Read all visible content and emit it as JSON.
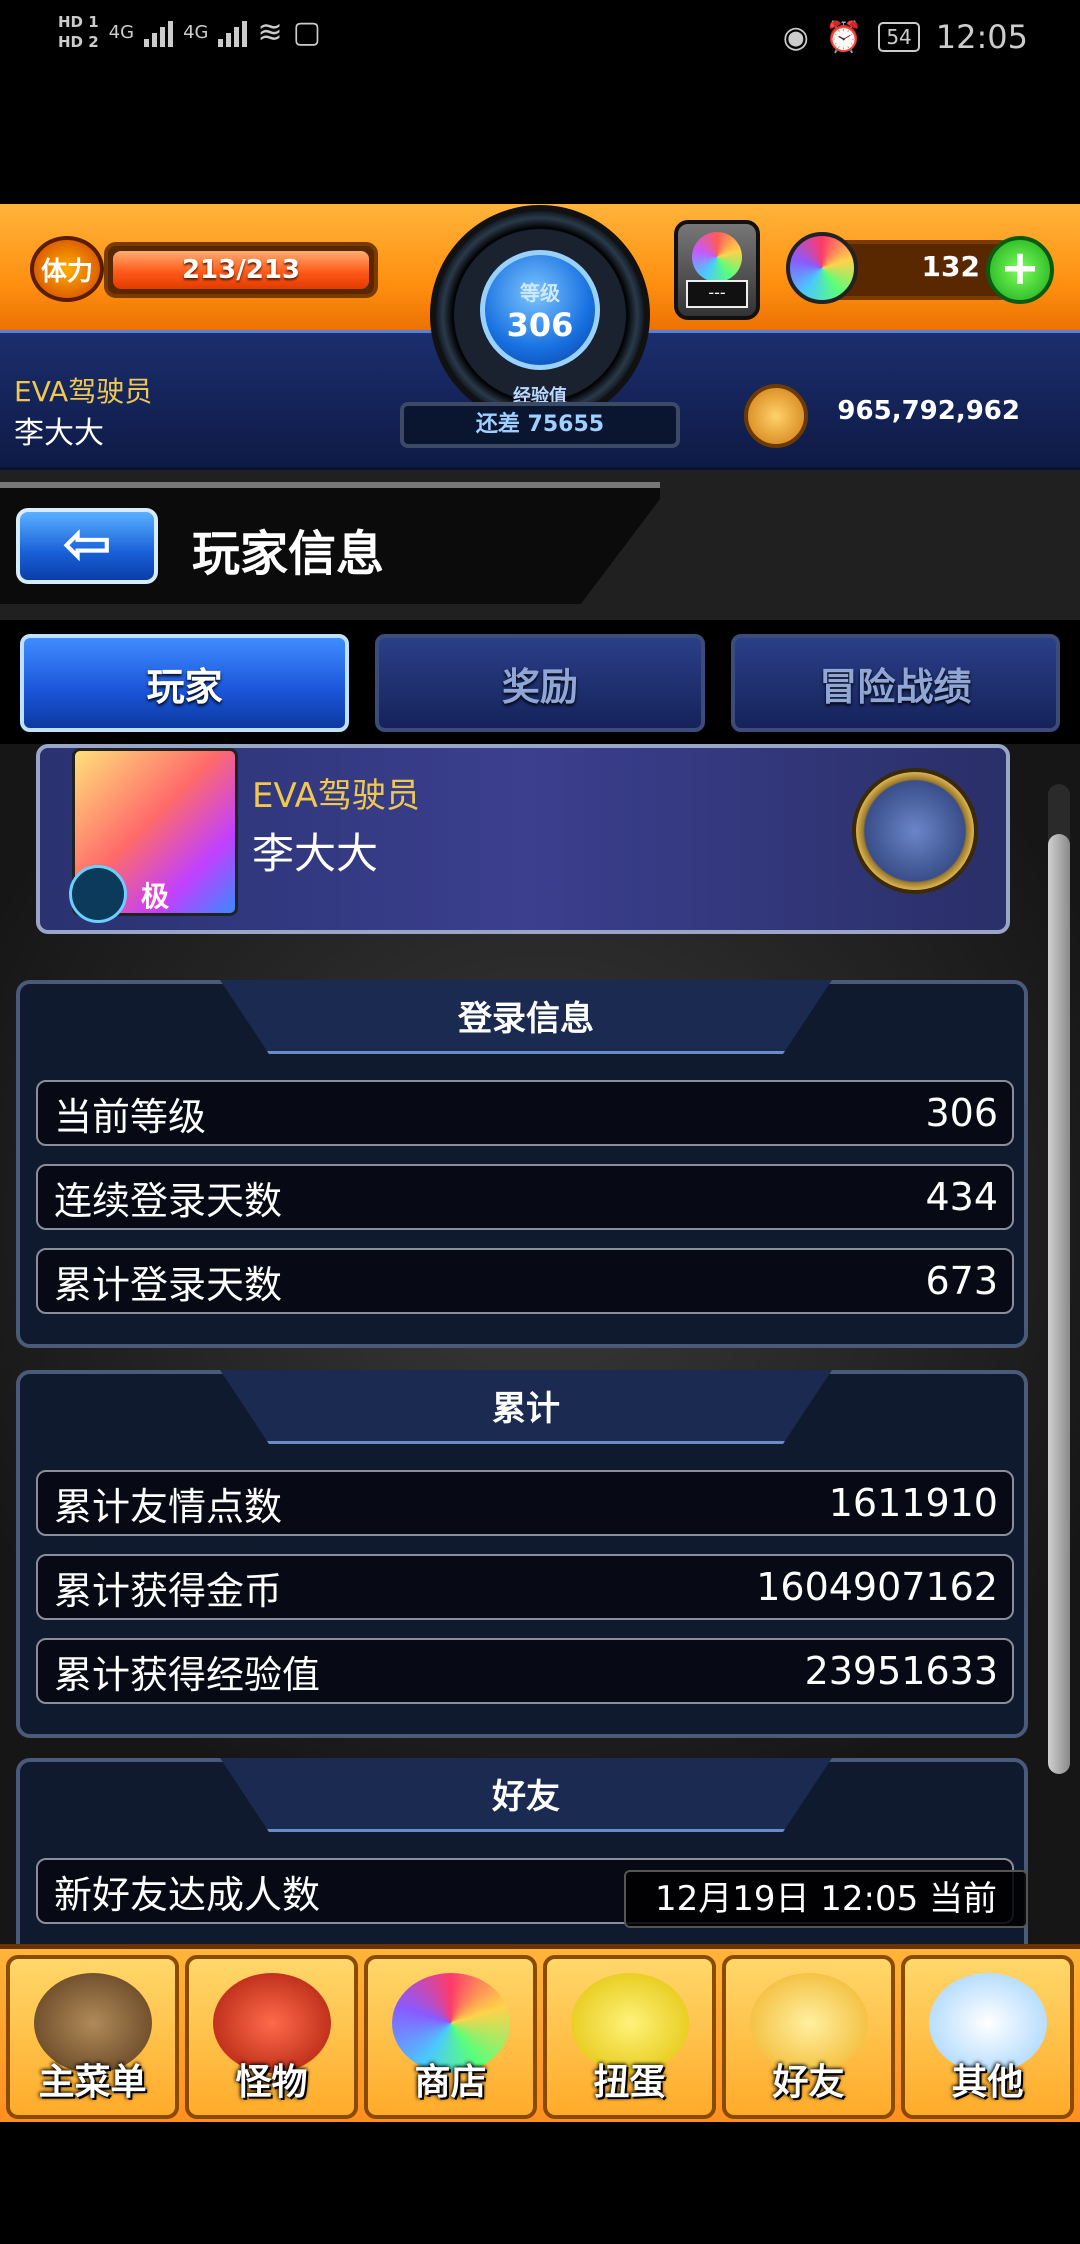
{
  "status_bar": {
    "hd1": "HD 1",
    "hd2": "HD 2",
    "net1": "4G",
    "net2": "4G",
    "battery": "54",
    "time": "12:05",
    "icons": [
      "eye-icon",
      "alarm-icon",
      "wifi-icon",
      "signal-icon"
    ]
  },
  "header": {
    "stamina_label": "体力",
    "stamina_text": "213/213",
    "stamina_fraction": 1.0,
    "level_label": "等级",
    "level_value": "306",
    "exp_label": "经验值",
    "exp_remaining": "还差 75655",
    "egg_slot_text": "---",
    "orb_count": "132",
    "add_label": "+",
    "subtitle": "EVA驾驶员",
    "player_name": "李大大",
    "gold": "965,792,962"
  },
  "page": {
    "title": "玩家信息",
    "back_label": "⇦"
  },
  "tabs": [
    {
      "label": "玩家",
      "active": true
    },
    {
      "label": "奖励",
      "active": false
    },
    {
      "label": "冒险战绩",
      "active": false
    }
  ],
  "profile": {
    "subtitle": "EVA驾驶员",
    "name": "李大大",
    "grade": "极"
  },
  "sections": {
    "login": {
      "title": "登录信息",
      "rows": [
        {
          "label": "当前等级",
          "value": "306"
        },
        {
          "label": "连续登录天数",
          "value": "434"
        },
        {
          "label": "累计登录天数",
          "value": "673"
        }
      ]
    },
    "totals": {
      "title": "累计",
      "rows": [
        {
          "label": "累计友情点数",
          "value": "1611910"
        },
        {
          "label": "累计获得金币",
          "value": "1604907162"
        },
        {
          "label": "累计获得经验值",
          "value": "23951633"
        }
      ]
    },
    "friends": {
      "title": "好友",
      "rows": [
        {
          "label": "新好友达成人数",
          "value": ""
        }
      ]
    }
  },
  "toast": "12月19日 12:05 当前",
  "bottom_nav": [
    {
      "label": "主菜单",
      "icon": "main-menu-icon"
    },
    {
      "label": "怪物",
      "icon": "monster-icon"
    },
    {
      "label": "商店",
      "icon": "shop-icon"
    },
    {
      "label": "扭蛋",
      "icon": "gacha-icon"
    },
    {
      "label": "好友",
      "icon": "friends-icon"
    },
    {
      "label": "其他",
      "icon": "other-icon"
    }
  ],
  "colors": {
    "accent_orange": "#ff9020",
    "tab_active": "#1a54d8",
    "gold_text": "#f0c850"
  }
}
